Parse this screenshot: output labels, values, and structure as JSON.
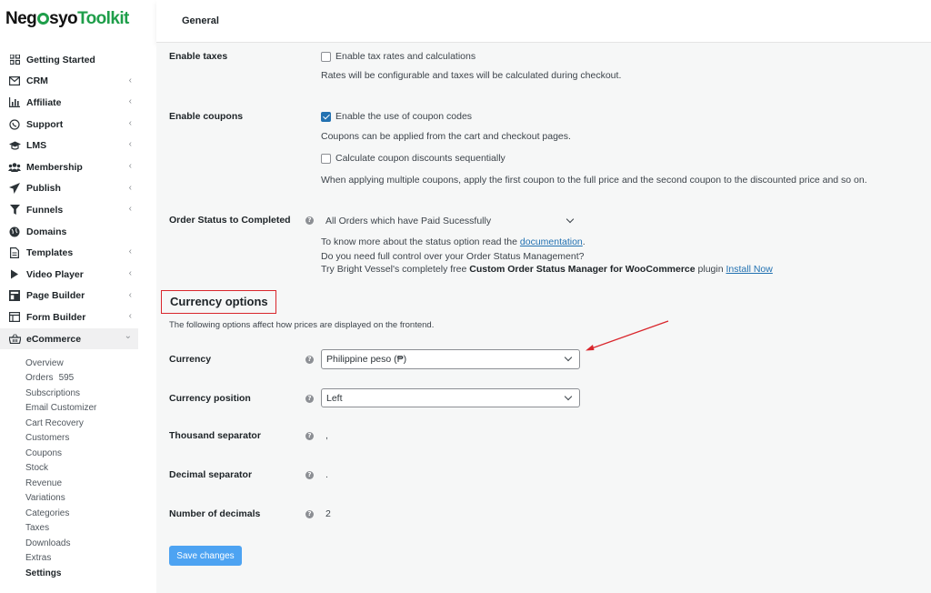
{
  "brand": {
    "logo_text": "NegosyoToolkit"
  },
  "sidebar": {
    "items": [
      {
        "label": "Getting Started",
        "icon": "grid-icon",
        "chevron": false
      },
      {
        "label": "CRM",
        "icon": "envelope-icon",
        "chevron": true
      },
      {
        "label": "Affiliate",
        "icon": "bar-chart-icon",
        "chevron": true
      },
      {
        "label": "Support",
        "icon": "whatsapp-icon",
        "chevron": true
      },
      {
        "label": "LMS",
        "icon": "graduation-cap-icon",
        "chevron": true
      },
      {
        "label": "Membership",
        "icon": "users-icon",
        "chevron": true
      },
      {
        "label": "Publish",
        "icon": "paper-plane-icon",
        "chevron": true
      },
      {
        "label": "Funnels",
        "icon": "filter-icon",
        "chevron": true
      },
      {
        "label": "Domains",
        "icon": "globe-icon",
        "chevron": false
      },
      {
        "label": "Templates",
        "icon": "document-icon",
        "chevron": true
      },
      {
        "label": "Video Player",
        "icon": "play-icon",
        "chevron": true
      },
      {
        "label": "Page Builder",
        "icon": "layout-icon",
        "chevron": true
      },
      {
        "label": "Form Builder",
        "icon": "form-icon",
        "chevron": true
      },
      {
        "label": "eCommerce",
        "icon": "basket-icon",
        "chevron": true,
        "expanded": true
      }
    ],
    "submenu": [
      {
        "label": "Overview"
      },
      {
        "label": "Orders",
        "count": "595"
      },
      {
        "label": "Subscriptions"
      },
      {
        "label": "Email Customizer"
      },
      {
        "label": "Cart Recovery"
      },
      {
        "label": "Customers"
      },
      {
        "label": "Coupons"
      },
      {
        "label": "Stock"
      },
      {
        "label": "Revenue"
      },
      {
        "label": "Variations"
      },
      {
        "label": "Categories"
      },
      {
        "label": "Taxes"
      },
      {
        "label": "Downloads"
      },
      {
        "label": "Extras"
      },
      {
        "label": "Settings",
        "current": true
      }
    ]
  },
  "topbar": {
    "tab": "General"
  },
  "settings": {
    "taxes": {
      "label": "Enable taxes",
      "checkbox_label": "Enable tax rates and calculations",
      "checked": false,
      "description": "Rates will be configurable and taxes will be calculated during checkout."
    },
    "coupons": {
      "label": "Enable coupons",
      "checkbox_label": "Enable the use of coupon codes",
      "checked": true,
      "description": "Coupons can be applied from the cart and checkout pages.",
      "sequential_label": "Calculate coupon discounts sequentially",
      "sequential_checked": false,
      "sequential_description": "When applying multiple coupons, apply the first coupon to the full price and the second coupon to the discounted price and so on."
    },
    "order_status": {
      "label": "Order Status to Completed",
      "value": "All Orders which have Paid Sucessfully",
      "line1_prefix": "To know more about the status option read the ",
      "line1_link": "documentation",
      "line1_suffix": ".",
      "line2": "Do you need full control over your Order Status Management?",
      "line3_prefix": "Try Bright Vessel's completely free ",
      "line3_strong": "Custom Order Status Manager for WooCommerce",
      "line3_mid": " plugin ",
      "line3_link": "Install Now"
    }
  },
  "currency": {
    "heading": "Currency options",
    "description": "The following options affect how prices are displayed on the frontend.",
    "currency": {
      "label": "Currency",
      "value": "Philippine peso (₱)"
    },
    "position": {
      "label": "Currency position",
      "value": "Left"
    },
    "thousand": {
      "label": "Thousand separator",
      "value": ","
    },
    "decimal": {
      "label": "Decimal separator",
      "value": "."
    },
    "decimals": {
      "label": "Number of decimals",
      "value": "2"
    }
  },
  "actions": {
    "save_label": "Save changes"
  },
  "colors": {
    "accent": "#2271b1",
    "button": "#4da3f2",
    "highlight": "#d9262c",
    "brand": "#1e9e4a"
  }
}
